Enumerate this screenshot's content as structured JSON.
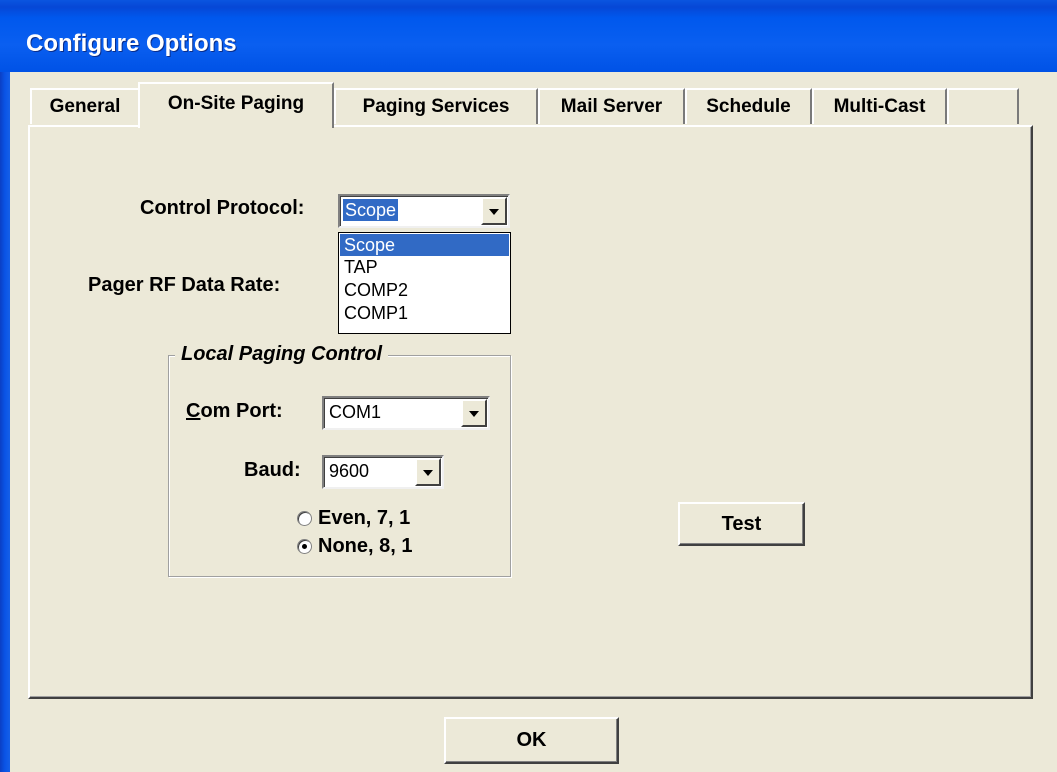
{
  "window": {
    "title": "Configure Options"
  },
  "tabs": [
    {
      "label": "General",
      "active": false
    },
    {
      "label": "On-Site Paging",
      "active": true
    },
    {
      "label": "Paging Services",
      "active": false
    },
    {
      "label": "Mail Server",
      "active": false
    },
    {
      "label": "Schedule",
      "active": false
    },
    {
      "label": "Multi-Cast",
      "active": false
    },
    {
      "label": "",
      "active": false
    }
  ],
  "control_protocol": {
    "label": "Control Protocol:",
    "value": "Scope",
    "options": [
      "Scope",
      "TAP",
      "COMP2",
      "COMP1"
    ],
    "highlighted": "Scope"
  },
  "pager_rf": {
    "label": "Pager RF Data Rate:"
  },
  "local_paging": {
    "legend": "Local Paging Control",
    "com_port": {
      "label_prefix": "C",
      "label_rest": "om Port:",
      "value": "COM1"
    },
    "baud": {
      "label": "Baud:",
      "value": "9600"
    },
    "parity": [
      {
        "label": "Even, 7, 1",
        "checked": false
      },
      {
        "label": "None, 8, 1",
        "checked": true
      }
    ]
  },
  "buttons": {
    "test": "Test",
    "ok": "OK"
  },
  "colors": {
    "titlebar": "#0058ee",
    "face": "#ece9d8",
    "selection": "#316ac5"
  }
}
